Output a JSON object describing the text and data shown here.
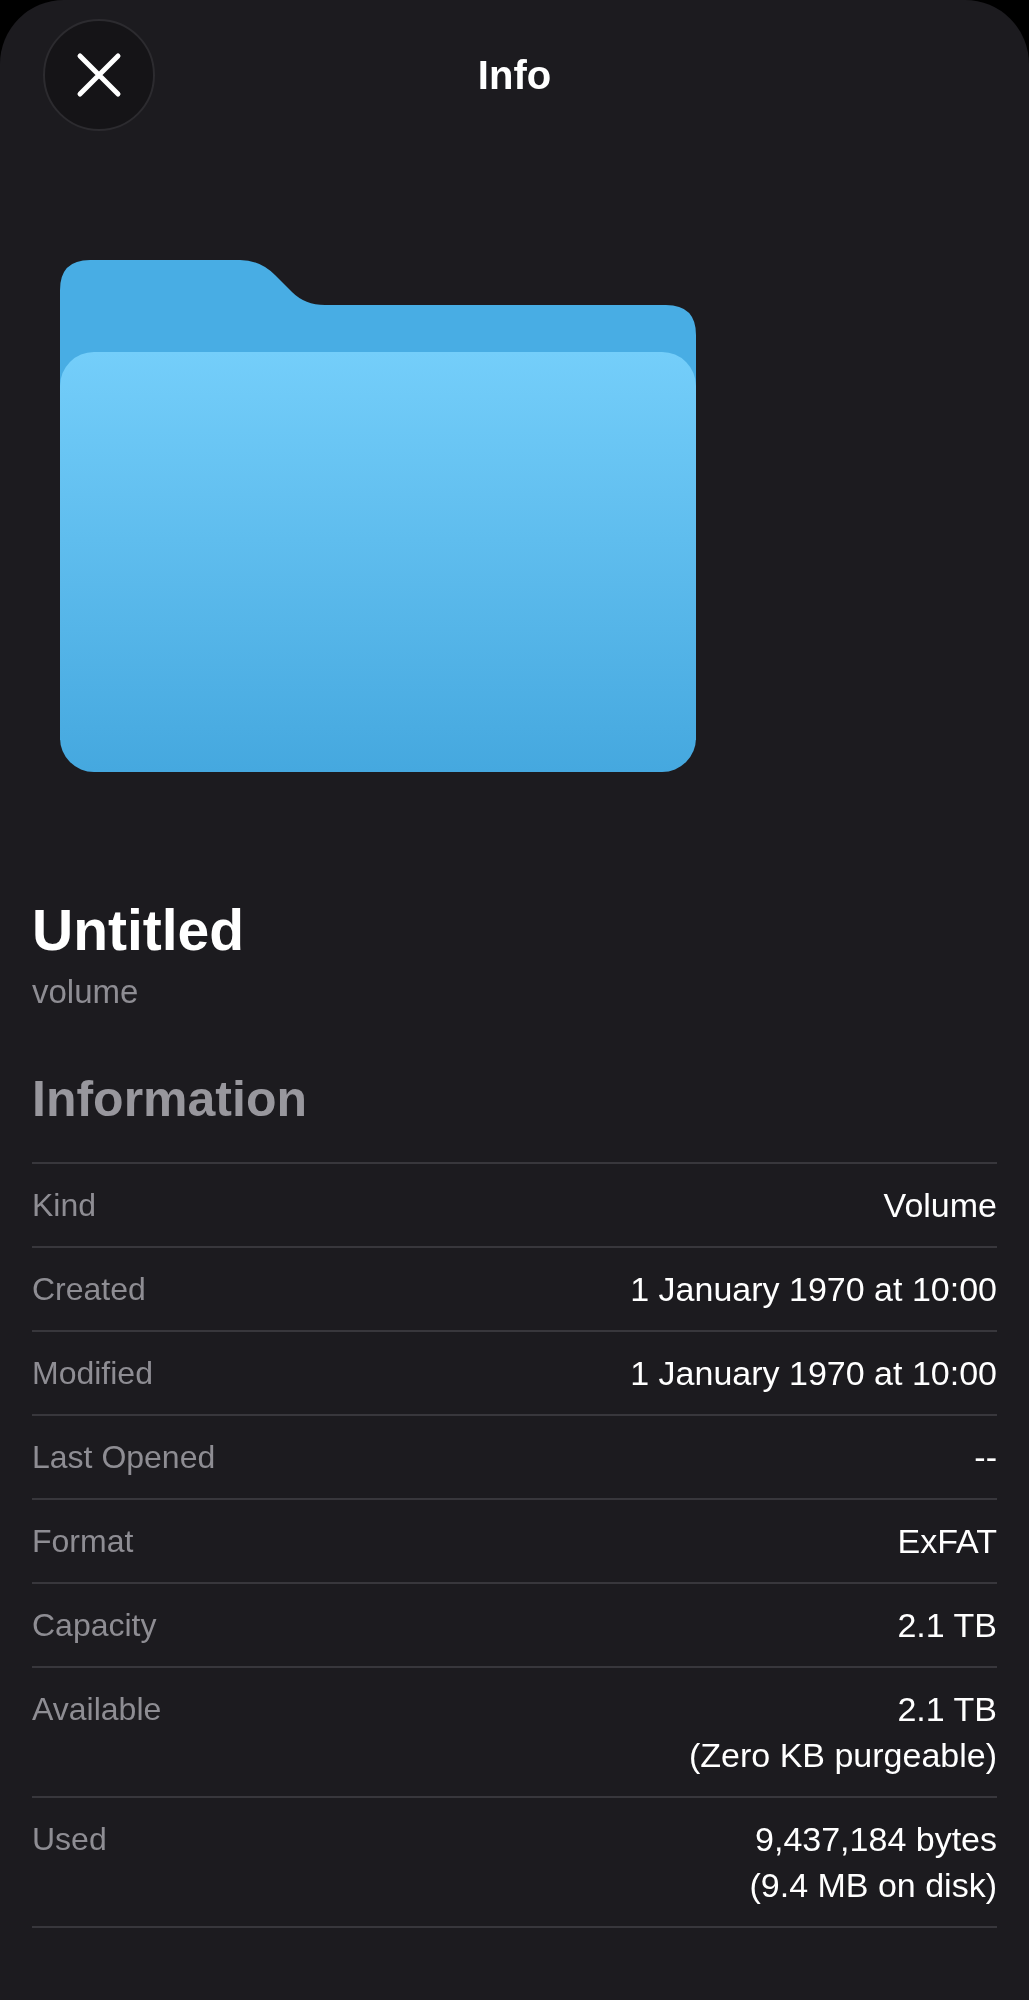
{
  "header": {
    "title": "Info"
  },
  "item": {
    "name": "Untitled",
    "kind": "volume"
  },
  "section": {
    "title": "Information"
  },
  "rows": [
    {
      "label": "Kind",
      "value": "Volume"
    },
    {
      "label": "Created",
      "value": "1 January 1970 at 10:00"
    },
    {
      "label": "Modified",
      "value": "1 January 1970 at 10:00"
    },
    {
      "label": "Last Opened",
      "value": "--"
    },
    {
      "label": "Format",
      "value": "ExFAT"
    },
    {
      "label": "Capacity",
      "value": "2.1 TB"
    },
    {
      "label": "Available",
      "value": "2.1 TB",
      "detail": "(Zero KB purgeable)"
    },
    {
      "label": "Used",
      "value": "9,437,184 bytes",
      "detail": "(9.4 MB on disk)"
    }
  ]
}
